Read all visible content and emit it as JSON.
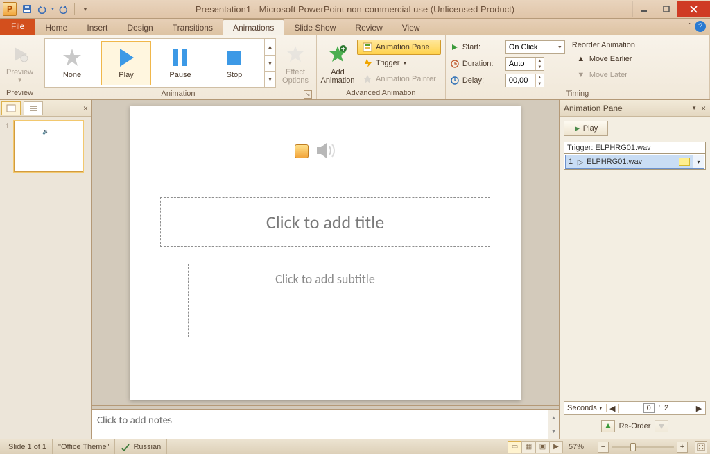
{
  "window": {
    "title": "Presentation1 - Microsoft PowerPoint non-commercial use (Unlicensed Product)",
    "app_letter": "P"
  },
  "tabs": {
    "file": "File",
    "items": [
      "Home",
      "Insert",
      "Design",
      "Transitions",
      "Animations",
      "Slide Show",
      "Review",
      "View"
    ],
    "active": "Animations"
  },
  "ribbon": {
    "preview": {
      "label": "Preview",
      "group": "Preview"
    },
    "animation": {
      "group": "Animation",
      "gallery": [
        {
          "label": "None"
        },
        {
          "label": "Play"
        },
        {
          "label": "Pause"
        },
        {
          "label": "Stop"
        }
      ],
      "selected": "Play",
      "effect_options": "Effect\nOptions"
    },
    "advanced": {
      "group": "Advanced Animation",
      "add": "Add\nAnimation",
      "pane": "Animation Pane",
      "trigger": "Trigger",
      "painter": "Animation Painter"
    },
    "timing": {
      "group": "Timing",
      "start_label": "Start:",
      "start_value": "On Click",
      "duration_label": "Duration:",
      "duration_value": "Auto",
      "delay_label": "Delay:",
      "delay_value": "00,00",
      "reorder_header": "Reorder Animation",
      "move_earlier": "Move Earlier",
      "move_later": "Move Later"
    }
  },
  "thumbs": {
    "slides": [
      {
        "num": "1"
      }
    ]
  },
  "slide": {
    "title_placeholder": "Click to add title",
    "subtitle_placeholder": "Click to add subtitle"
  },
  "notes": {
    "placeholder": "Click to add notes"
  },
  "anim_pane": {
    "title": "Animation Pane",
    "play": "Play",
    "trigger_label": "Trigger: ELPHRG01.wav",
    "item": {
      "index": "1",
      "name": "ELPHRG01.wav"
    },
    "seconds": "Seconds",
    "current": "0",
    "total": "2",
    "reorder": "Re-Order"
  },
  "status": {
    "slide": "Slide 1 of 1",
    "theme": "\"Office Theme\"",
    "lang": "Russian",
    "zoom": "57%"
  }
}
